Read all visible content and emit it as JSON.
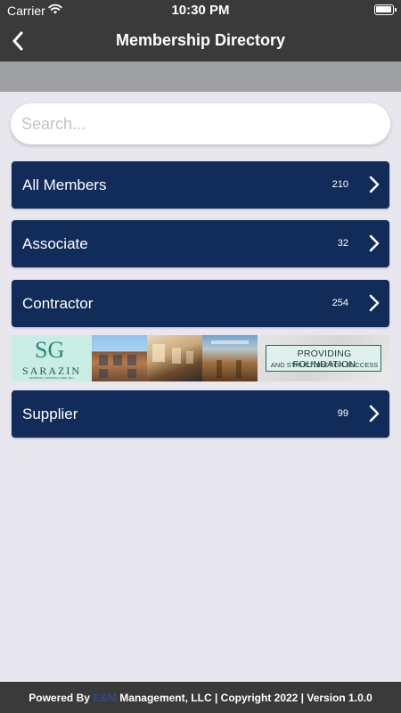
{
  "status_bar": {
    "carrier": "Carrier",
    "time": "10:30 PM"
  },
  "nav": {
    "title": "Membership Directory",
    "back_icon": "chevron-left-icon"
  },
  "search": {
    "placeholder": "Search...",
    "value": ""
  },
  "categories": [
    {
      "label": "All Members",
      "count": "210"
    },
    {
      "label": "Associate",
      "count": "32"
    },
    {
      "label": "Contractor",
      "count": "254"
    },
    {
      "label": "Supplier",
      "count": "99"
    }
  ],
  "banner": {
    "logo_monogram": "SG",
    "logo_name": "SARAZIN",
    "logo_subtitle": "GENERAL CONTRACTORS, INC.",
    "tagline_line1": "PROVIDING FOUNDATION",
    "tagline_line2": "AND STRUCTURE FOR SUCCESS"
  },
  "footer": {
    "prefix": "Powered By ",
    "brand": "E&M",
    "suffix": " Management, LLC | Copyright 2022 | Version 1.0.0"
  },
  "colors": {
    "header_bg": "#3a3a3b",
    "row_bg": "#122c5a",
    "page_bg": "#e8e7ee",
    "gray_band": "#9fa0a2"
  }
}
